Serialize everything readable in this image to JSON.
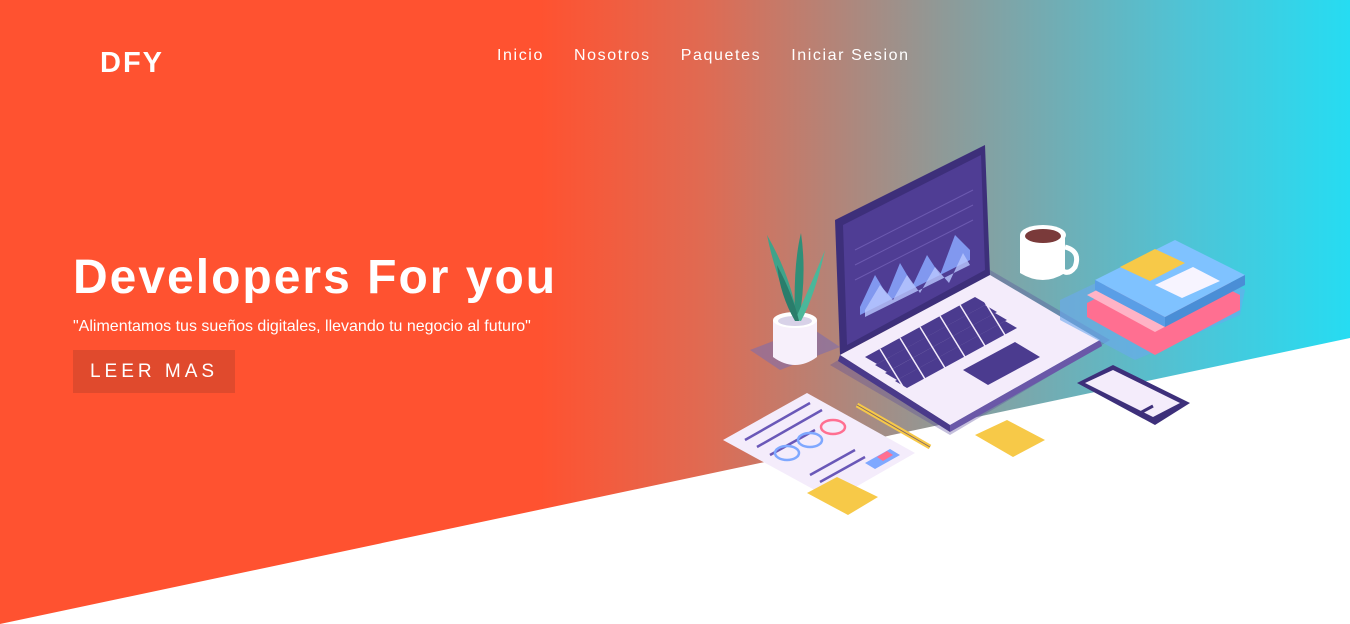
{
  "brand": {
    "logo_text": "DFY"
  },
  "nav": {
    "items": [
      {
        "label": "Inicio"
      },
      {
        "label": "Nosotros"
      },
      {
        "label": "Paquetes"
      },
      {
        "label": "Iniciar Sesion"
      }
    ]
  },
  "hero": {
    "title": "Developers For you",
    "subtitle": "\"Alimentamos tus sueños digitales, llevando tu negocio al futuro\"",
    "cta_label": "LEER MAS",
    "illustration_icon": "workspace-laptop-illustration"
  },
  "colors": {
    "primary": "#ff5230",
    "accent": "#26dcf2",
    "button": "#e04a2d",
    "text": "#ffffff"
  }
}
